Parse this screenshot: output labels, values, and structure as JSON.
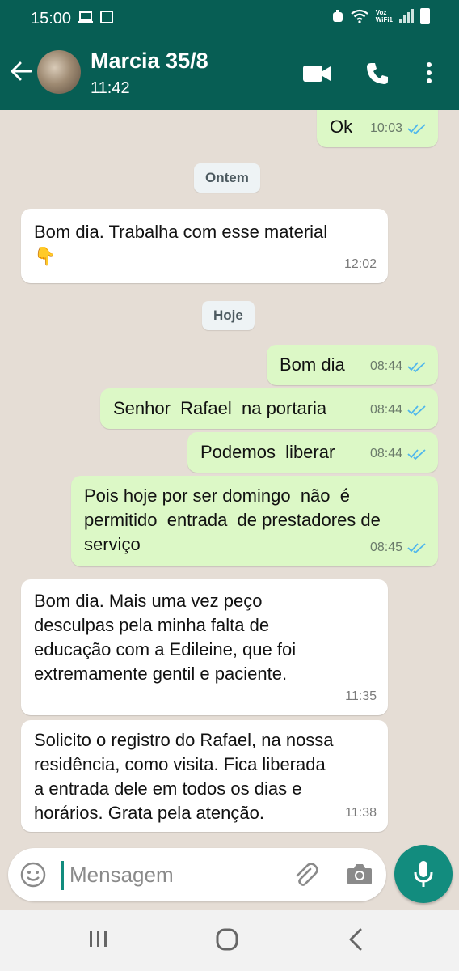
{
  "status_bar": {
    "time": "15:00",
    "voz": "Voz",
    "wifi_label": "WiFi1"
  },
  "header": {
    "contact_name": "Marcia 35/8",
    "status": "11:42"
  },
  "messages": [
    {
      "direction": "out",
      "text": "Ok",
      "time": "10:03",
      "read": true
    },
    {
      "type": "date",
      "label": "Ontem"
    },
    {
      "direction": "in",
      "text": "Bom dia. Trabalha com esse material",
      "emoji": "👇",
      "time": "12:02"
    },
    {
      "type": "date",
      "label": "Hoje"
    },
    {
      "direction": "out",
      "text": "Bom dia",
      "time": "08:44",
      "read": true
    },
    {
      "direction": "out",
      "text": "Senhor  Rafael  na portaria",
      "time": "08:44",
      "read": true
    },
    {
      "direction": "out",
      "text": "Podemos  liberar",
      "time": "08:44",
      "read": true
    },
    {
      "direction": "out",
      "lines": [
        "Pois hoje por ser domingo  não  é",
        "permitido  entrada  de prestadores de",
        "serviço"
      ],
      "time": "08:45",
      "read": true
    },
    {
      "direction": "in",
      "lines": [
        "Bom dia. Mais uma vez peço",
        "desculpas pela minha falta de",
        "educação com a Edileine, que foi",
        "extremamente gentil e paciente."
      ],
      "time": "11:35"
    },
    {
      "direction": "in",
      "lines": [
        "Solicito o registro do Rafael, na nossa",
        "residência, como visita. Fica liberada",
        "a entrada dele em todos os dias e",
        "horários. Grata pela atenção."
      ],
      "time": "11:38"
    }
  ],
  "composer": {
    "placeholder": "Mensagem"
  },
  "colors": {
    "header": "#075e54",
    "outgoing_bubble": "#dcf8c6",
    "incoming_bubble": "#ffffff",
    "chat_background": "#e5ddd5",
    "accent": "#128c7e",
    "read_ticks": "#4fb6ec"
  },
  "icons": [
    "back-arrow-icon",
    "video-call-icon",
    "phone-icon",
    "more-options-icon",
    "emoji-icon",
    "attach-clip-icon",
    "camera-icon",
    "mic-icon",
    "recent-apps-icon",
    "home-icon",
    "nav-back-icon"
  ]
}
